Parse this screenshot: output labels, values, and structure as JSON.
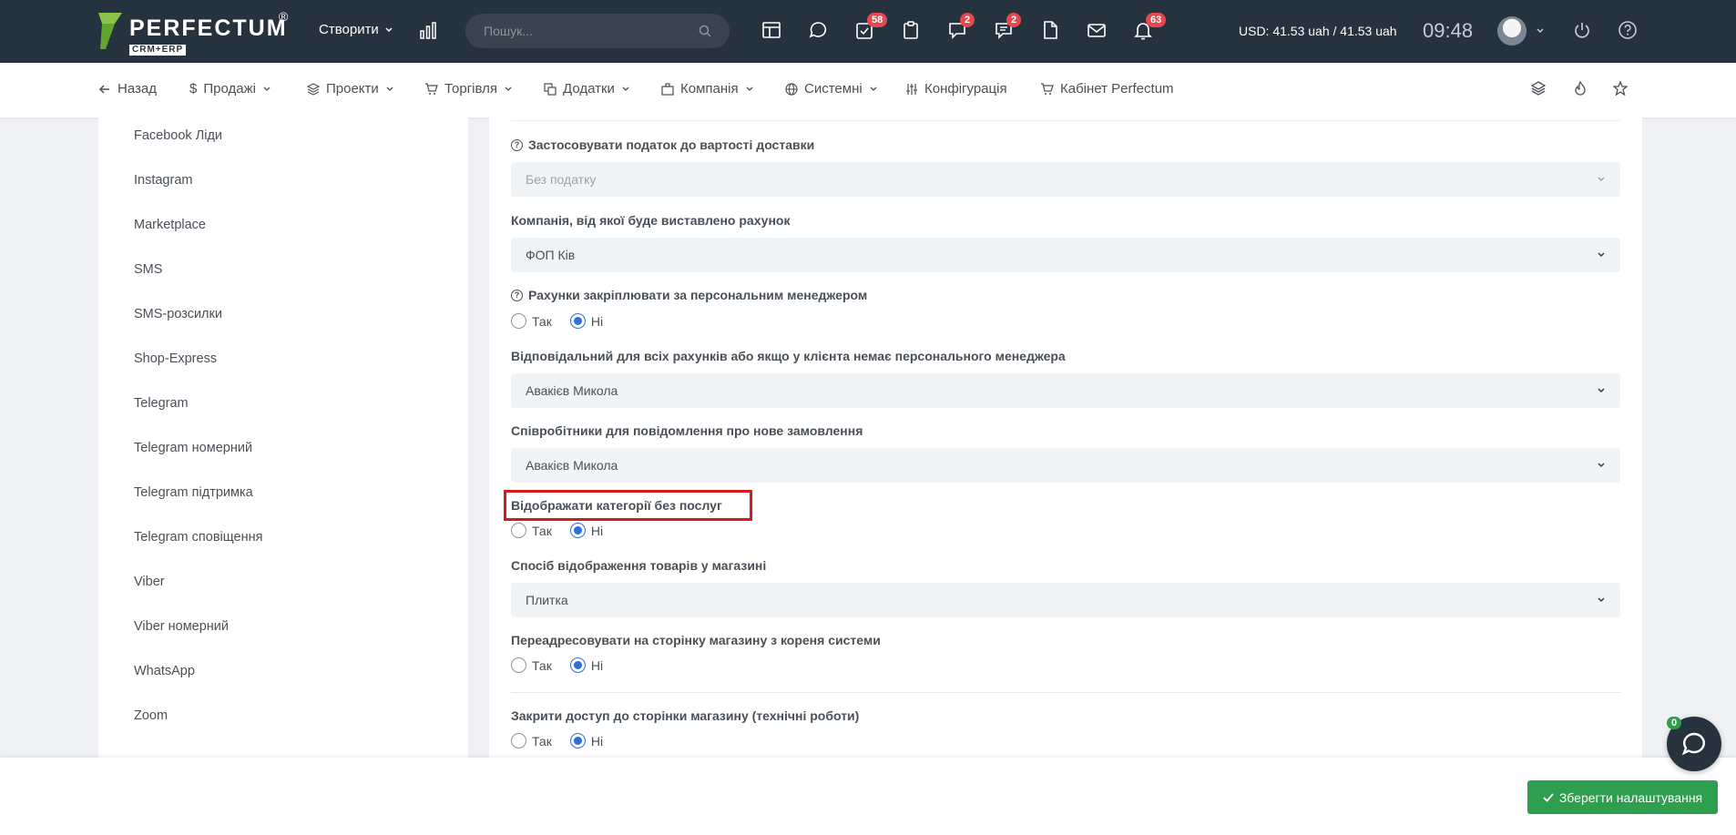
{
  "header": {
    "logo_text": "PERFECTUM",
    "logo_reg": "®",
    "logo_sub": "CRM+ERP",
    "create_label": "Створити",
    "search_placeholder": "Пошук...",
    "badges": {
      "tasks": "58",
      "chat_support": "2",
      "messages": "2",
      "notifications": "63"
    },
    "currency": "USD: 41.53 uah / 41.53 uah",
    "time": "09:48"
  },
  "nav": {
    "back": "Назад",
    "sales": "Продажі",
    "projects": "Проекти",
    "trade": "Торгівля",
    "addons": "Додатки",
    "company": "Компанія",
    "system": "Системні",
    "configuration": "Конфігурація",
    "cabinet": "Кабінет Perfectum"
  },
  "sidebar": {
    "items": [
      {
        "label": "Facebook Ліди"
      },
      {
        "label": "Instagram"
      },
      {
        "label": "Marketplace"
      },
      {
        "label": "SMS"
      },
      {
        "label": "SMS-розсилки"
      },
      {
        "label": "Shop-Express"
      },
      {
        "label": "Telegram"
      },
      {
        "label": "Telegram номерний"
      },
      {
        "label": "Telegram підтримка"
      },
      {
        "label": "Telegram сповіщення"
      },
      {
        "label": "Viber"
      },
      {
        "label": "Viber номерний"
      },
      {
        "label": "WhatsApp"
      },
      {
        "label": "Zoom"
      }
    ]
  },
  "form": {
    "yes": "Так",
    "no": "Ні",
    "tax_label": "Застосовувати податок до вартості доставки",
    "tax_value": "Без податку",
    "company_label": "Компанія, від якої буде виставлено рахунок",
    "company_value": "ФОП Ків",
    "assign_label": "Рахунки закріплювати за персональним менеджером",
    "responsible_label": "Відповідальний для всіх рахунків або якщо у клієнта немає персонального менеджера",
    "responsible_value": "Авакієв Микола",
    "notify_label": "Співробітники для повідомлення про нове замовлення",
    "notify_value": "Авакієв Микола",
    "categories_label": "Відображати категорії без послуг",
    "display_label": "Спосіб відображення товарів у магазині",
    "display_value": "Плитка",
    "redirect_label": "Переадресовувати на сторінку магазину з кореня системи",
    "close_label": "Закрити доступ до сторінки магазину (технічні роботи)"
  },
  "footer": {
    "save_label": "Зберегти налаштування",
    "chat_badge": "0"
  },
  "colors": {
    "topbar": "#27323f",
    "accent_blue": "#2f6fdb",
    "save_green": "#2e9e4f",
    "badge_red": "#e5484d",
    "highlight_red": "#d9191f"
  }
}
